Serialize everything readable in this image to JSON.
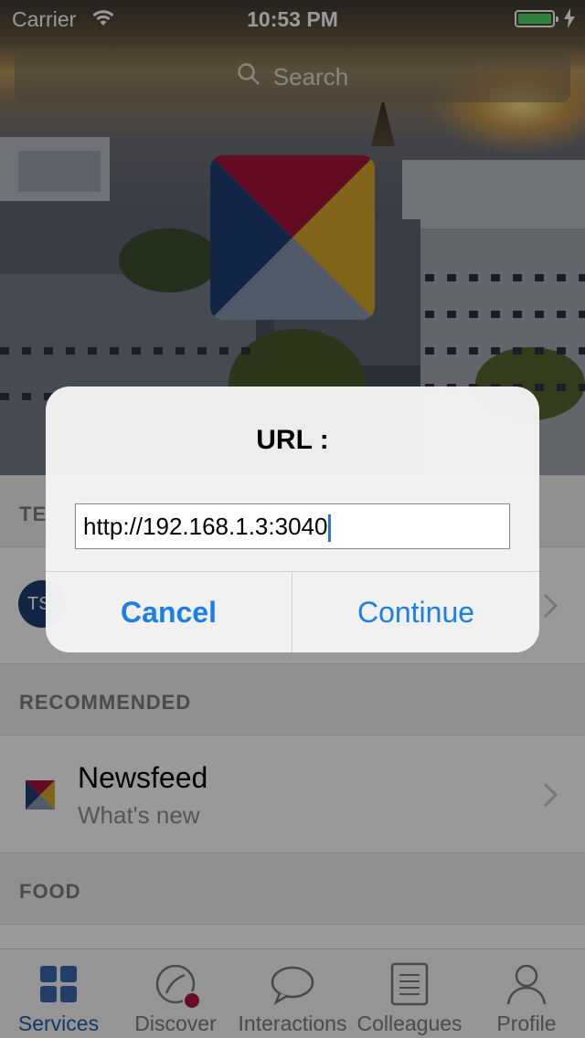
{
  "status_bar": {
    "carrier": "Carrier",
    "time": "10:53 PM"
  },
  "search": {
    "placeholder": "Search"
  },
  "sections": [
    {
      "header": "TE"
    },
    {
      "header": "RECOMMENDED",
      "rows": [
        {
          "title": "Newsfeed",
          "subtitle": "What's new"
        }
      ]
    },
    {
      "header": "FOOD"
    }
  ],
  "team_row": {
    "avatar_initials": "TS"
  },
  "tabbar": {
    "tabs": [
      {
        "label": "Services",
        "icon": "grid-icon",
        "active": true
      },
      {
        "label": "Discover",
        "icon": "compass-icon"
      },
      {
        "label": "Interactions",
        "icon": "chat-bubble-icon"
      },
      {
        "label": "Colleagues",
        "icon": "list-icon"
      },
      {
        "label": "Profile",
        "icon": "person-icon"
      }
    ]
  },
  "dialog": {
    "title": "URL :",
    "url_value": "http://192.168.1.3:3040",
    "cancel_label": "Cancel",
    "continue_label": "Continue"
  },
  "colors": {
    "accent": "#1a7fe6",
    "tab_active": "#1f5fa8",
    "logo_red": "#a8153b",
    "logo_yellow": "#d6a72a",
    "logo_blue": "#1f3e73",
    "logo_gray": "#8696ad"
  }
}
